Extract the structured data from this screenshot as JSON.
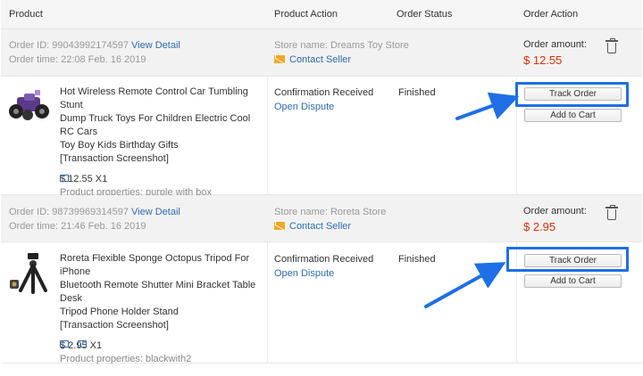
{
  "header": {
    "product": "Product",
    "product_action": "Product Action",
    "order_status": "Order Status",
    "order_action": "Order Action"
  },
  "orders": [
    {
      "order_id_label": "Order ID:",
      "order_id": "99043992174597",
      "view_detail": "View Detail",
      "order_time_label": "Order time:",
      "order_time": "22:08 Feb. 16 2019",
      "store_label": "Store name:",
      "store_name": "Dreams Toy Store",
      "contact_seller": "Contact Seller",
      "amount_label": "Order amount:",
      "amount": "$ 12.55",
      "product_title_1": "Hot Wireless Remote Control Car Tumbling Stunt",
      "product_title_2": "Dump Truck Toys For Children Electric Cool RC Cars",
      "product_title_3": "Toy Boy Kids Birthday Gifts",
      "transaction": "[Transaction Screenshot]",
      "price_qty": "$ 12.55 X1",
      "properties": "Product properties: purple with box",
      "action_status": "Confirmation Received",
      "open_dispute": "Open Dispute",
      "order_status": "Finished",
      "track_order": "Track Order",
      "add_to_cart": "Add to Cart"
    },
    {
      "order_id_label": "Order ID:",
      "order_id": "98739969314597",
      "view_detail": "View Detail",
      "order_time_label": "Order time:",
      "order_time": "21:46 Feb. 16 2019",
      "store_label": "Store name:",
      "store_name": "Roreta Store",
      "contact_seller": "Contact Seller",
      "amount_label": "Order amount:",
      "amount": "$ 2.95",
      "product_title_1": "Roreta Flexible Sponge Octopus Tripod For iPhone",
      "product_title_2": "Bluetooth Remote Shutter Mini Bracket Table Desk",
      "product_title_3": "Tripod Phone Holder Stand",
      "transaction": "[Transaction Screenshot]",
      "price_qty": "$ 2.95 X1",
      "properties": "Product properties: blackwith2",
      "action_status": "Confirmation Received",
      "open_dispute": "Open Dispute",
      "order_status": "Finished",
      "track_order": "Track Order",
      "add_to_cart": "Add to Cart"
    }
  ],
  "colors": {
    "link": "#2f6cb5",
    "price": "#e62e04",
    "highlight": "#1e6fe6"
  }
}
